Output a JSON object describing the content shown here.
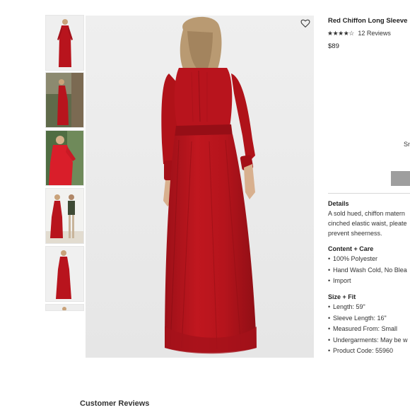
{
  "product": {
    "title": "Red Chiffon Long Sleeve",
    "rating_stars": "★★★★☆",
    "review_count": "12 Reviews",
    "rating_value": 4,
    "price": "$89",
    "size_peek": "Sm"
  },
  "details": {
    "heading": "Details",
    "lines": [
      "A sold hued, chiffon matern",
      "cinched elastic waist, pleate",
      "prevent sheerness."
    ]
  },
  "content_care": {
    "heading": "Content + Care",
    "items": [
      "100% Polyester",
      "Hand Wash Cold, No Blea",
      "Import"
    ]
  },
  "size_fit": {
    "heading": "Size + Fit",
    "items": [
      "Length: 59\"",
      "Sleeve Length: 16\"",
      "Measured From: Small",
      "Undergarments: May be w",
      "Product Code: 55960"
    ]
  },
  "customer_reviews": "Customer Reviews",
  "colors": {
    "dress_red": "#b8141d",
    "dress_shadow": "#8e0d14",
    "background_gray": "#ececec",
    "button_gray": "#9e9e9e"
  },
  "icons": {
    "wishlist": "heart-outline-icon",
    "rating": "star-icon"
  }
}
